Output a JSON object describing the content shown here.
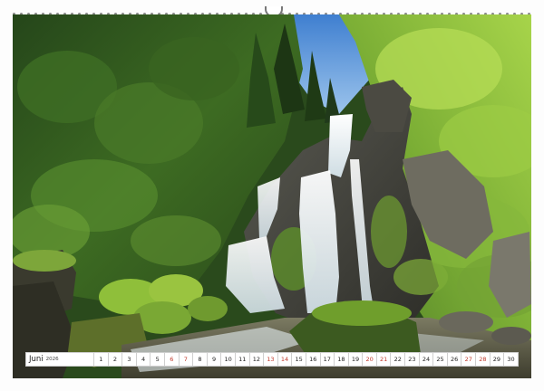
{
  "calendar": {
    "month": "Juni",
    "year": "2026",
    "days": [
      {
        "n": "1",
        "type": "weekday"
      },
      {
        "n": "2",
        "type": "weekday"
      },
      {
        "n": "3",
        "type": "weekday"
      },
      {
        "n": "4",
        "type": "weekday"
      },
      {
        "n": "5",
        "type": "weekday"
      },
      {
        "n": "6",
        "type": "weekend"
      },
      {
        "n": "7",
        "type": "weekend"
      },
      {
        "n": "8",
        "type": "weekday"
      },
      {
        "n": "9",
        "type": "weekday"
      },
      {
        "n": "10",
        "type": "weekday"
      },
      {
        "n": "11",
        "type": "weekday"
      },
      {
        "n": "12",
        "type": "weekday"
      },
      {
        "n": "13",
        "type": "weekend"
      },
      {
        "n": "14",
        "type": "weekend"
      },
      {
        "n": "15",
        "type": "weekday"
      },
      {
        "n": "16",
        "type": "weekday"
      },
      {
        "n": "17",
        "type": "weekday"
      },
      {
        "n": "18",
        "type": "weekday"
      },
      {
        "n": "19",
        "type": "weekday"
      },
      {
        "n": "20",
        "type": "weekend"
      },
      {
        "n": "21",
        "type": "weekend"
      },
      {
        "n": "22",
        "type": "weekday"
      },
      {
        "n": "23",
        "type": "weekday"
      },
      {
        "n": "24",
        "type": "weekday"
      },
      {
        "n": "25",
        "type": "weekday"
      },
      {
        "n": "26",
        "type": "weekday"
      },
      {
        "n": "27",
        "type": "weekend"
      },
      {
        "n": "28",
        "type": "weekend"
      },
      {
        "n": "29",
        "type": "weekday"
      },
      {
        "n": "30",
        "type": "weekday"
      }
    ]
  },
  "colors": {
    "weekend_text": "#c0392b",
    "weekday_text": "#222222",
    "foliage_dark": "#1f3a18",
    "foliage_light": "#8fbf3a",
    "sky": "#4f8fd6",
    "water": "#e9f1f4"
  }
}
